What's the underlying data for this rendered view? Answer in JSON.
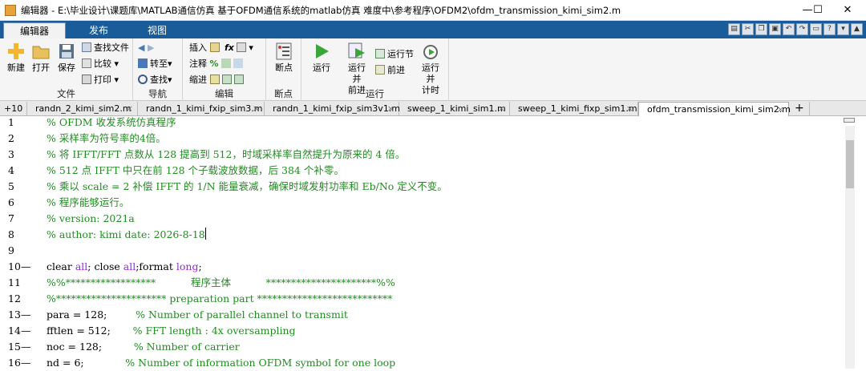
{
  "window": {
    "title": "编辑器 - E:\\毕业设计\\课题库\\MATLAB通信仿真 基于OFDM通信系统的matlab仿真 难度中\\参考程序\\OFDM2\\ofdm_transmission_kimi_sim2.m",
    "minimize": "—",
    "maximize": "☐",
    "close": "✕"
  },
  "ribbon_tabs": [
    "编辑器",
    "发布",
    "视图"
  ],
  "ribbon": {
    "file": {
      "label": "文件",
      "new": "新建",
      "open": "打开",
      "save": "保存",
      "find_files": "查找文件",
      "compare": "比较",
      "print": "打印"
    },
    "nav": {
      "label": "导航",
      "goto": "转至",
      "find": "查找"
    },
    "edit": {
      "label": "编辑",
      "insert": "插入",
      "comment": "注释",
      "indent": "缩进",
      "fx": "fx",
      "pct": "%"
    },
    "breakpoints": {
      "label": "断点",
      "bp": "断点"
    },
    "run": {
      "label": "运行",
      "run": "运行",
      "run_advance": "运行并\n前进",
      "run_section": "运行节",
      "advance": "前进",
      "run_time": "运行并\n计时"
    }
  },
  "file_tabs": {
    "zoom": "+10",
    "tabs": [
      "randn_2_kimi_sim2.m",
      "randn_1_kimi_fxip_sim3.m",
      "randn_1_kimi_fxip_sim3v1.m",
      "sweep_1_kimi_sim1.m",
      "sweep_1_kimi_fixp_sim1.m",
      "ofdm_transmission_kimi_sim2.m"
    ],
    "add": "+"
  },
  "code": {
    "lines": [
      {
        "n": "1",
        "dash": "",
        "text": "% OFDM 收发系统仿真程序"
      },
      {
        "n": "2",
        "dash": "",
        "text": "% 采样率为符号率的4倍。"
      },
      {
        "n": "3",
        "dash": "",
        "text": "% 将 IFFT/FFT 点数从 128 提高到 512，时域采样率自然提升为原来的 4 倍。"
      },
      {
        "n": "4",
        "dash": "",
        "text": "% 512 点 IFFT 中只在前 128 个子载波放数据，后 384 个补零。"
      },
      {
        "n": "5",
        "dash": "",
        "text": "% 乘以 scale = 2 补偿 IFFT 的 1/N 能量衰减，确保时域发射功率和 Eb/No 定义不变。"
      },
      {
        "n": "6",
        "dash": "",
        "text": "% 程序能够运行。"
      },
      {
        "n": "7",
        "dash": "",
        "text": "% version: 2021a"
      },
      {
        "n": "8",
        "dash": "",
        "text": "% author: kimi date: 2026-8-18"
      },
      {
        "n": "9",
        "dash": "",
        "text": ""
      },
      {
        "n": "10",
        "dash": "—",
        "text": "clear all; close all;format long;"
      },
      {
        "n": "11",
        "dash": "",
        "text": "%%******************           程序主体           **********************%%"
      },
      {
        "n": "12",
        "dash": "",
        "text": "%********************** preparation part ***************************"
      },
      {
        "n": "13",
        "dash": "—",
        "text": "para = 128;         % Number of parallel channel to transmit"
      },
      {
        "n": "14",
        "dash": "—",
        "text": "fftlen = 512;       % FFT length : 4x oversampling"
      },
      {
        "n": "15",
        "dash": "—",
        "text": "noc = 128;          % Number of carrier"
      },
      {
        "n": "16",
        "dash": "—",
        "text": "nd = 6;             % Number of information OFDM symbol for one loop"
      }
    ],
    "colors": {
      "comment": "#228b22",
      "keyword": "#0000ff",
      "string": "#a020f0"
    }
  }
}
